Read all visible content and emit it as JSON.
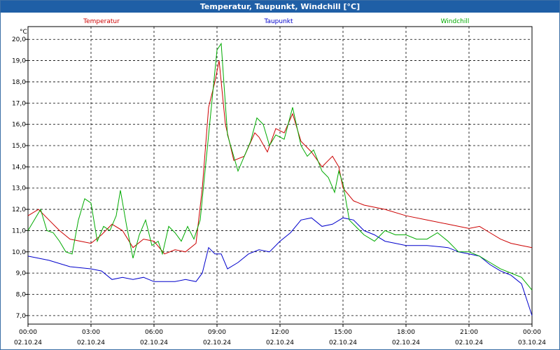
{
  "window": {
    "title": "Temperatur, Taupunkt, Windchill [°C]"
  },
  "chart_data": {
    "type": "line",
    "title": "Temperatur, Taupunkt, Windchill [°C]",
    "ylabel": "°C",
    "ylim": [
      6.6,
      20.6
    ],
    "yticks": [
      "20,0",
      "19,0",
      "18,0",
      "17,0",
      "16,0",
      "15,0",
      "14,0",
      "13,0",
      "12,0",
      "11,0",
      "10,0",
      "9,0",
      "8,0",
      "7,0"
    ],
    "xticks": [
      {
        "time": "00:00",
        "date": "02.10.24"
      },
      {
        "time": "03:00",
        "date": "02.10.24"
      },
      {
        "time": "06:00",
        "date": "02.10.24"
      },
      {
        "time": "09:00",
        "date": "02.10.24"
      },
      {
        "time": "12:00",
        "date": "02.10.24"
      },
      {
        "time": "15:00",
        "date": "02.10.24"
      },
      {
        "time": "18:00",
        "date": "02.10.24"
      },
      {
        "time": "21:00",
        "date": "02.10.24"
      },
      {
        "time": "00:00",
        "date": "03.10.24"
      }
    ],
    "grid": true,
    "legend_position": "top",
    "series": [
      {
        "name": "Temperatur",
        "color": "#cc0000",
        "points": [
          [
            0,
            11.7
          ],
          [
            0.5,
            12.0
          ],
          [
            1.0,
            11.5
          ],
          [
            1.5,
            11.0
          ],
          [
            2.0,
            10.6
          ],
          [
            2.5,
            10.5
          ],
          [
            3.0,
            10.4
          ],
          [
            3.5,
            10.8
          ],
          [
            4.0,
            11.3
          ],
          [
            4.5,
            11.0
          ],
          [
            5.0,
            10.2
          ],
          [
            5.5,
            10.6
          ],
          [
            6.0,
            10.5
          ],
          [
            6.5,
            9.9
          ],
          [
            7.0,
            10.1
          ],
          [
            7.5,
            10.0
          ],
          [
            8.0,
            10.4
          ],
          [
            8.3,
            13.0
          ],
          [
            8.6,
            16.8
          ],
          [
            8.9,
            18.0
          ],
          [
            9.1,
            19.0
          ],
          [
            9.4,
            16.0
          ],
          [
            9.8,
            14.3
          ],
          [
            10.3,
            14.5
          ],
          [
            10.8,
            15.6
          ],
          [
            11.0,
            15.4
          ],
          [
            11.4,
            14.7
          ],
          [
            11.8,
            15.8
          ],
          [
            12.2,
            15.6
          ],
          [
            12.6,
            16.5
          ],
          [
            13.0,
            15.2
          ],
          [
            13.5,
            14.7
          ],
          [
            14.0,
            14.0
          ],
          [
            14.5,
            14.5
          ],
          [
            14.8,
            14.0
          ],
          [
            15.0,
            13.0
          ],
          [
            15.5,
            12.4
          ],
          [
            16.0,
            12.2
          ],
          [
            17.0,
            12.0
          ],
          [
            18.0,
            11.7
          ],
          [
            19.0,
            11.5
          ],
          [
            20.0,
            11.3
          ],
          [
            21.0,
            11.1
          ],
          [
            21.5,
            11.2
          ],
          [
            22.0,
            10.9
          ],
          [
            22.5,
            10.6
          ],
          [
            23.0,
            10.4
          ],
          [
            23.5,
            10.3
          ],
          [
            24.0,
            10.2
          ]
        ]
      },
      {
        "name": "Taupunkt",
        "color": "#0000cc",
        "points": [
          [
            0,
            9.8
          ],
          [
            1.0,
            9.6
          ],
          [
            2.0,
            9.3
          ],
          [
            3.0,
            9.2
          ],
          [
            3.5,
            9.1
          ],
          [
            4.0,
            8.7
          ],
          [
            4.5,
            8.8
          ],
          [
            5.0,
            8.7
          ],
          [
            5.5,
            8.8
          ],
          [
            6.0,
            8.6
          ],
          [
            7.0,
            8.6
          ],
          [
            7.5,
            8.7
          ],
          [
            8.0,
            8.6
          ],
          [
            8.3,
            9.0
          ],
          [
            8.6,
            10.2
          ],
          [
            8.9,
            9.9
          ],
          [
            9.2,
            9.9
          ],
          [
            9.5,
            9.2
          ],
          [
            10.0,
            9.5
          ],
          [
            10.5,
            9.9
          ],
          [
            11.0,
            10.1
          ],
          [
            11.5,
            10.0
          ],
          [
            12.0,
            10.5
          ],
          [
            12.5,
            10.9
          ],
          [
            13.0,
            11.5
          ],
          [
            13.5,
            11.6
          ],
          [
            14.0,
            11.2
          ],
          [
            14.5,
            11.3
          ],
          [
            15.0,
            11.6
          ],
          [
            15.5,
            11.5
          ],
          [
            16.0,
            11.0
          ],
          [
            16.5,
            10.8
          ],
          [
            17.0,
            10.5
          ],
          [
            17.5,
            10.4
          ],
          [
            18.0,
            10.3
          ],
          [
            19.0,
            10.3
          ],
          [
            20.0,
            10.2
          ],
          [
            20.5,
            10.0
          ],
          [
            21.0,
            9.9
          ],
          [
            21.5,
            9.8
          ],
          [
            22.0,
            9.4
          ],
          [
            22.5,
            9.1
          ],
          [
            23.0,
            8.9
          ],
          [
            23.5,
            8.5
          ],
          [
            24.0,
            7.0
          ]
        ]
      },
      {
        "name": "Windchill",
        "color": "#00aa00",
        "points": [
          [
            0,
            11.0
          ],
          [
            0.3,
            11.5
          ],
          [
            0.6,
            12.0
          ],
          [
            0.9,
            11.0
          ],
          [
            1.2,
            10.9
          ],
          [
            1.5,
            10.5
          ],
          [
            1.8,
            10.0
          ],
          [
            2.1,
            9.9
          ],
          [
            2.4,
            11.5
          ],
          [
            2.7,
            12.5
          ],
          [
            3.0,
            12.3
          ],
          [
            3.3,
            10.5
          ],
          [
            3.6,
            11.2
          ],
          [
            3.9,
            11.0
          ],
          [
            4.2,
            11.7
          ],
          [
            4.4,
            12.9
          ],
          [
            4.7,
            11.2
          ],
          [
            5.0,
            9.7
          ],
          [
            5.3,
            10.8
          ],
          [
            5.6,
            11.5
          ],
          [
            5.9,
            10.3
          ],
          [
            6.2,
            10.5
          ],
          [
            6.4,
            9.9
          ],
          [
            6.7,
            11.2
          ],
          [
            7.0,
            10.9
          ],
          [
            7.3,
            10.5
          ],
          [
            7.6,
            11.2
          ],
          [
            7.9,
            10.6
          ],
          [
            8.2,
            11.5
          ],
          [
            8.5,
            14.5
          ],
          [
            8.8,
            17.5
          ],
          [
            9.0,
            19.5
          ],
          [
            9.2,
            19.8
          ],
          [
            9.5,
            15.5
          ],
          [
            10.0,
            13.8
          ],
          [
            10.3,
            14.5
          ],
          [
            10.6,
            15.2
          ],
          [
            10.9,
            16.3
          ],
          [
            11.2,
            16.0
          ],
          [
            11.5,
            15.0
          ],
          [
            11.8,
            15.5
          ],
          [
            12.2,
            15.3
          ],
          [
            12.6,
            16.8
          ],
          [
            13.0,
            15.0
          ],
          [
            13.3,
            14.5
          ],
          [
            13.6,
            14.8
          ],
          [
            14.0,
            13.8
          ],
          [
            14.3,
            13.5
          ],
          [
            14.6,
            12.8
          ],
          [
            14.8,
            13.8
          ],
          [
            15.0,
            13.2
          ],
          [
            15.3,
            11.5
          ],
          [
            15.6,
            11.2
          ],
          [
            16.0,
            10.8
          ],
          [
            16.5,
            10.5
          ],
          [
            17.0,
            11.0
          ],
          [
            17.5,
            10.8
          ],
          [
            18.0,
            10.8
          ],
          [
            18.5,
            10.6
          ],
          [
            19.0,
            10.6
          ],
          [
            19.5,
            10.9
          ],
          [
            20.0,
            10.5
          ],
          [
            20.5,
            10.0
          ],
          [
            21.0,
            10.0
          ],
          [
            21.5,
            9.8
          ],
          [
            22.0,
            9.5
          ],
          [
            22.5,
            9.2
          ],
          [
            23.0,
            9.0
          ],
          [
            23.5,
            8.8
          ],
          [
            24.0,
            8.2
          ]
        ]
      }
    ]
  }
}
